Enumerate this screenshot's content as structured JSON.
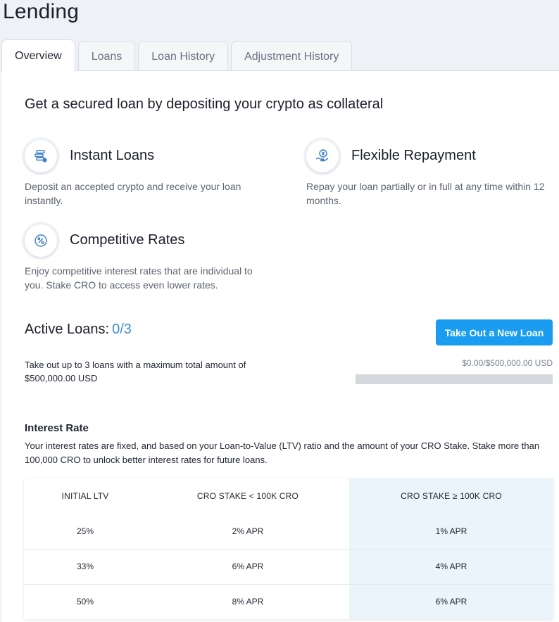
{
  "page": {
    "title": "Lending"
  },
  "tabs": [
    {
      "label": "Overview",
      "active": true
    },
    {
      "label": "Loans",
      "active": false
    },
    {
      "label": "Loan History",
      "active": false
    },
    {
      "label": "Adjustment History",
      "active": false
    }
  ],
  "overview": {
    "headline": "Get a secured loan by depositing your crypto as collateral",
    "features": [
      {
        "icon": "coins-stack-icon",
        "title": "Instant Loans",
        "description": "Deposit an accepted crypto and receive your loan instantly."
      },
      {
        "icon": "hand-dollar-icon",
        "title": "Flexible Repayment",
        "description": "Repay your loan partially or in full at any time within 12 months."
      },
      {
        "icon": "percent-icon",
        "title": "Competitive Rates",
        "description": "Enjoy competitive interest rates that are individual to you. Stake CRO to access even lower rates."
      }
    ]
  },
  "active_loans": {
    "label": "Active Loans:",
    "count": "0/3",
    "description": "Take out up to 3 loans with a maximum total amount of $500,000.00 USD",
    "button_label": "Take Out a New Loan",
    "limit_text": "$0.00/$500,000.00 USD",
    "progress": 0
  },
  "interest_rate": {
    "title": "Interest Rate",
    "description": "Your interest rates are fixed, and based on your Loan-to-Value (LTV) ratio and the amount of your CRO Stake. Stake more than 100,000 CRO to unlock better interest rates for future loans.",
    "headers": [
      "INITIAL LTV",
      "CRO STAKE < 100K CRO",
      "CRO STAKE ≥ 100K CRO"
    ],
    "rows": [
      [
        "25%",
        "2% APR",
        "1% APR"
      ],
      [
        "33%",
        "6% APR",
        "4% APR"
      ],
      [
        "50%",
        "8% APR",
        "6% APR"
      ]
    ]
  },
  "colors": {
    "accent": "#1a9df0",
    "count": "#3b8fd9",
    "highlight_column": "#eaf4fb",
    "icon": "#3b7fc4"
  }
}
